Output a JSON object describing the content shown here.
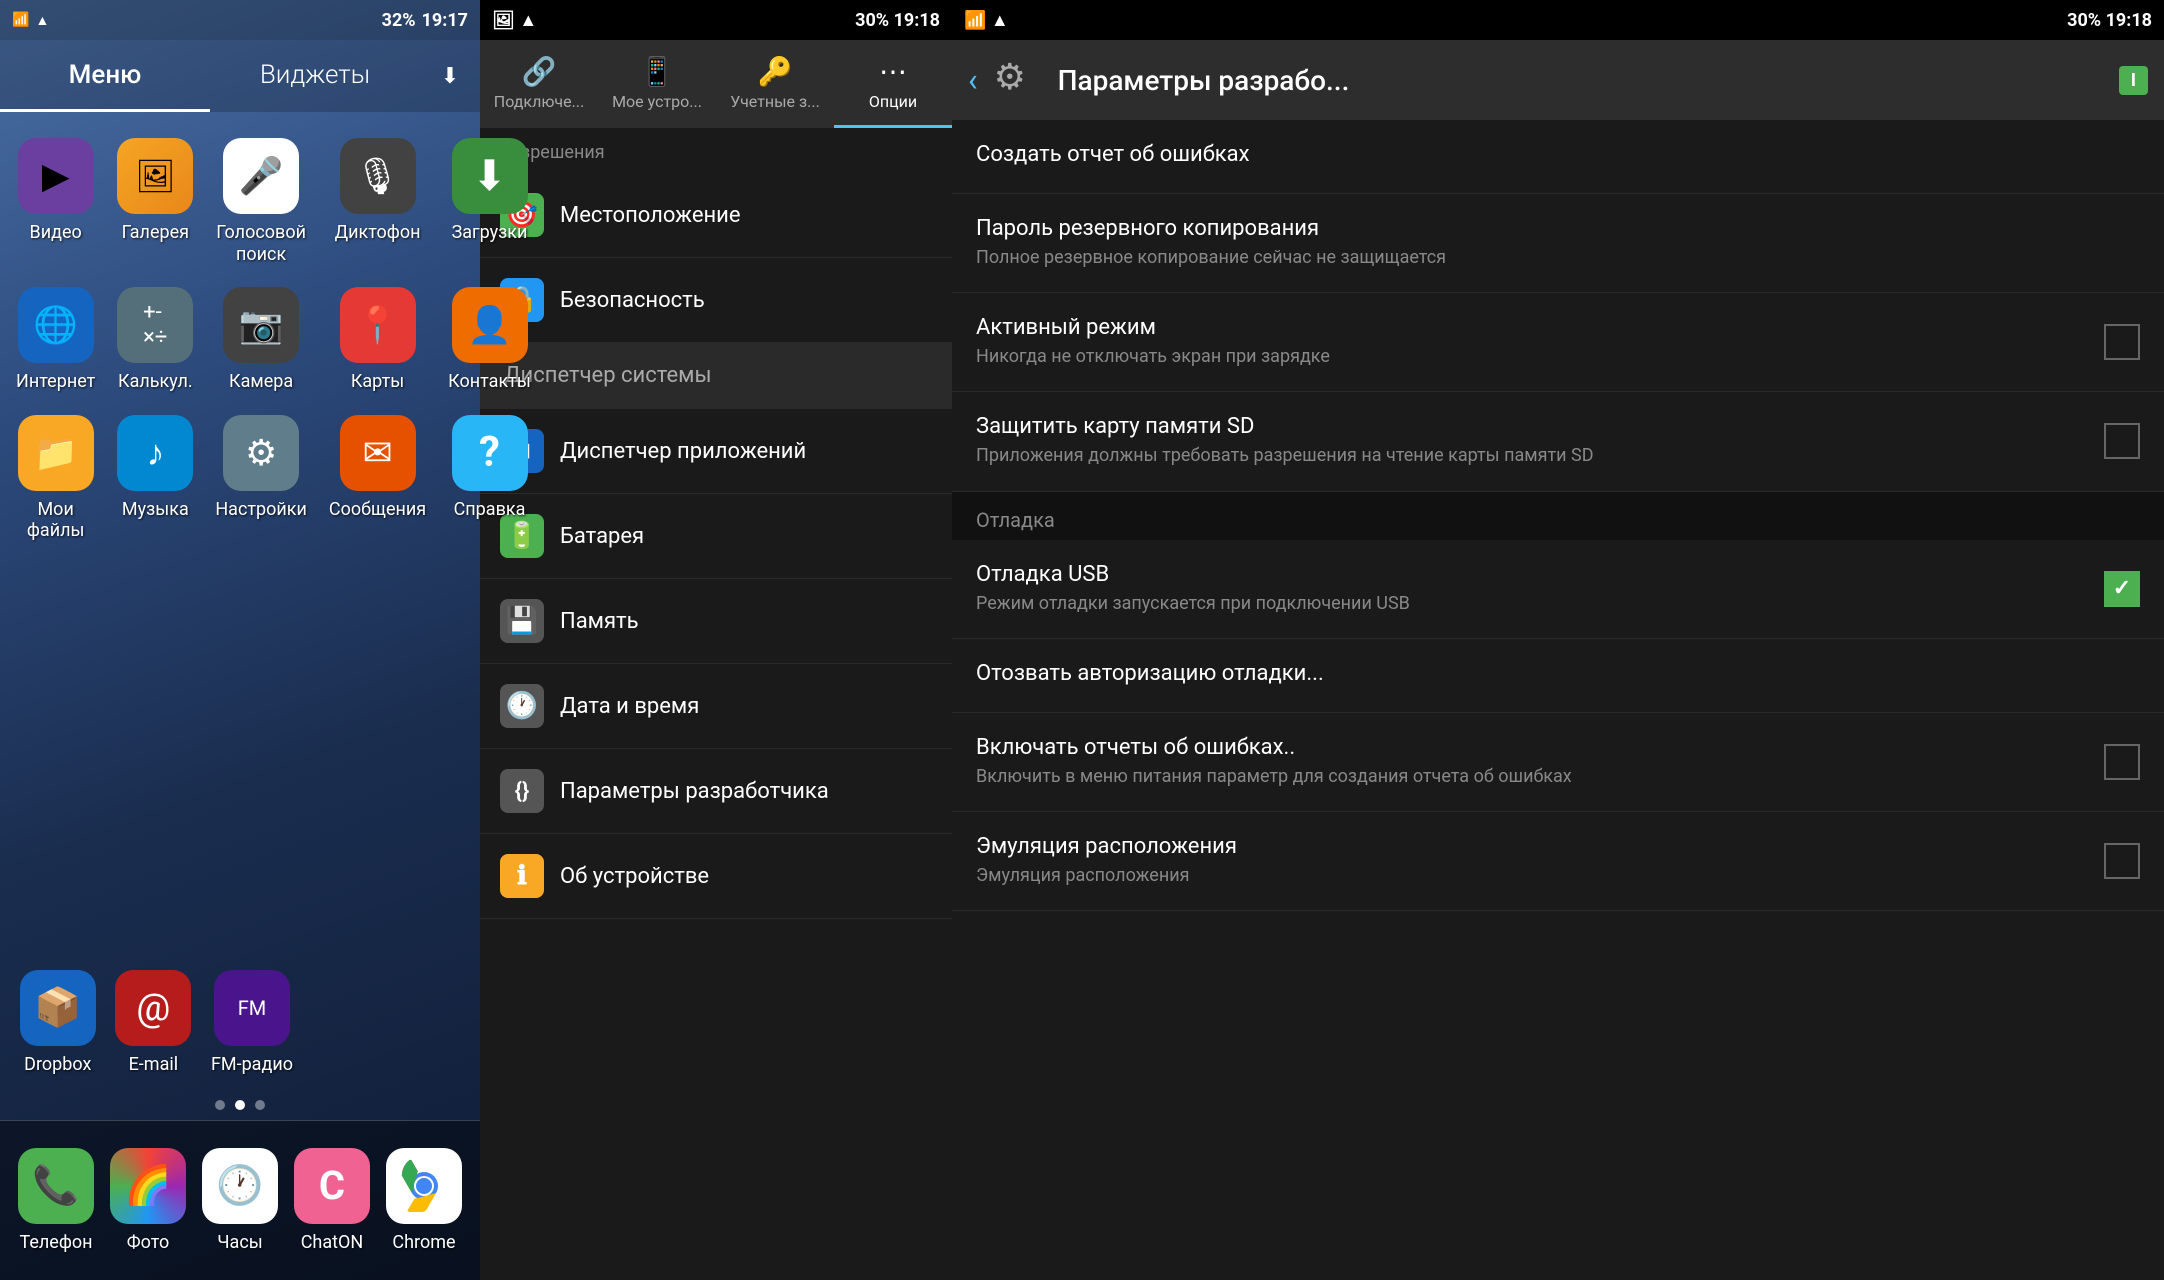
{
  "home": {
    "status_bar": {
      "time": "19:17",
      "battery": "32%",
      "signal_icon": "📶",
      "wifi_icon": "📡"
    },
    "tabs": [
      {
        "label": "Меню",
        "active": true
      },
      {
        "label": "Виджеты",
        "active": false
      }
    ],
    "download_icon": "⬇",
    "apps": [
      {
        "label": "Видео",
        "icon": "▶",
        "color": "icon-video"
      },
      {
        "label": "Галерея",
        "icon": "🖼",
        "color": "icon-gallery"
      },
      {
        "label": "Голосовой поиск",
        "icon": "🎤",
        "color": "icon-voice"
      },
      {
        "label": "Диктофон",
        "icon": "🎙",
        "color": "icon-dictaphone"
      },
      {
        "label": "Загрузки",
        "icon": "⬇",
        "color": "icon-downloads"
      },
      {
        "label": "Интернет",
        "icon": "🌐",
        "color": "icon-internet"
      },
      {
        "label": "Калькул.",
        "icon": "+-\n×÷",
        "color": "icon-calc"
      },
      {
        "label": "Камера",
        "icon": "📷",
        "color": "icon-camera"
      },
      {
        "label": "Карты",
        "icon": "📍",
        "color": "icon-maps"
      },
      {
        "label": "Контакты",
        "icon": "👤",
        "color": "icon-contacts"
      },
      {
        "label": "Мои файлы",
        "icon": "📁",
        "color": "icon-myfiles"
      },
      {
        "label": "Музыка",
        "icon": "♪",
        "color": "icon-music"
      },
      {
        "label": "Настройки",
        "icon": "⚙",
        "color": "icon-settings"
      },
      {
        "label": "Сообщения",
        "icon": "✉",
        "color": "icon-messages"
      },
      {
        "label": "Справка",
        "icon": "?",
        "color": "icon-help"
      }
    ],
    "dock": [
      {
        "label": "Телефон",
        "icon": "📞",
        "color": "icon-phone"
      },
      {
        "label": "Фото",
        "icon": "🌈",
        "color": "icon-photos"
      },
      {
        "label": "Часы",
        "icon": "🕐",
        "color": "icon-clock"
      },
      {
        "label": "ChatON",
        "icon": "C",
        "color": "icon-chaton"
      },
      {
        "label": "Chrome",
        "icon": "◎",
        "color": "icon-chrome"
      }
    ],
    "bottom_row": [
      {
        "label": "Dropbox",
        "icon": "📦",
        "color": "icon-dropbox"
      },
      {
        "label": "E-mail",
        "icon": "📧",
        "color": "icon-email"
      },
      {
        "label": "FM-радио",
        "icon": "📻",
        "color": "icon-fmradio"
      }
    ],
    "page_dots": [
      false,
      true,
      false
    ]
  },
  "settings": {
    "status_bar": {
      "time": "19:18",
      "battery": "30%"
    },
    "tabs": [
      {
        "label": "Подключе...",
        "icon": "🔗",
        "active": false
      },
      {
        "label": "Мое устро...",
        "icon": "📱",
        "active": false
      },
      {
        "label": "Учетные з...",
        "icon": "🔑",
        "active": false
      },
      {
        "label": "Опции",
        "icon": "⋯",
        "active": true
      }
    ],
    "section_header": "Разрешения",
    "items": [
      {
        "label": "Местоположение",
        "icon": "🎯",
        "icon_bg": "#4caf50",
        "highlighted": false
      },
      {
        "label": "Безопасность",
        "icon": "🔒",
        "icon_bg": "#2196f3",
        "highlighted": false
      },
      {
        "label": "Диспетчер системы",
        "icon": "",
        "icon_bg": "",
        "highlighted": true,
        "is_section": true
      },
      {
        "label": "Диспетчер приложений",
        "icon": "⊞",
        "icon_bg": "#1565c0",
        "highlighted": false
      },
      {
        "label": "Батарея",
        "icon": "🔋",
        "icon_bg": "#4caf50",
        "highlighted": false
      },
      {
        "label": "Память",
        "icon": "💾",
        "icon_bg": "#555",
        "highlighted": false
      },
      {
        "label": "Дата и время",
        "icon": "🕐",
        "icon_bg": "#555",
        "highlighted": false
      },
      {
        "label": "Параметры разработчика",
        "icon": "{}",
        "icon_bg": "#555",
        "highlighted": false
      },
      {
        "label": "Об устройстве",
        "icon": "ℹ",
        "icon_bg": "#f9a825",
        "highlighted": false
      }
    ]
  },
  "devopt": {
    "status_bar": {
      "time": "19:18",
      "battery": "30%"
    },
    "toolbar": {
      "title": "Параметры разрабо...",
      "battery_label": "I"
    },
    "items": [
      {
        "title": "Создать отчет об ошибках",
        "subtitle": "",
        "has_checkbox": false,
        "checked": false,
        "is_section": false
      },
      {
        "title": "Пароль резервного копирования",
        "subtitle": "Полное резервное копирование сейчас не защищается",
        "has_checkbox": false,
        "checked": false,
        "is_section": false
      },
      {
        "title": "Активный режим",
        "subtitle": "Никогда не отключать экран при зарядке",
        "has_checkbox": true,
        "checked": false,
        "is_section": false
      },
      {
        "title": "Защитить карту памяти SD",
        "subtitle": "Приложения должны требовать разрешения на чтение карты памяти SD",
        "has_checkbox": true,
        "checked": false,
        "is_section": false
      },
      {
        "title": "Отладка",
        "subtitle": "",
        "has_checkbox": false,
        "checked": false,
        "is_section": true
      },
      {
        "title": "Отладка USB",
        "subtitle": "Режим отладки запускается при подключении USB",
        "has_checkbox": true,
        "checked": true,
        "is_section": false
      },
      {
        "title": "Отозвать авторизацию отладки...",
        "subtitle": "",
        "has_checkbox": false,
        "checked": false,
        "is_section": false
      },
      {
        "title": "Включать отчеты об ошибках..",
        "subtitle": "Включить в меню питания параметр для создания отчета об ошибках",
        "has_checkbox": true,
        "checked": false,
        "is_section": false
      },
      {
        "title": "Эмуляция расположения",
        "subtitle": "Эмуляция расположения",
        "has_checkbox": true,
        "checked": false,
        "is_section": false
      }
    ]
  }
}
